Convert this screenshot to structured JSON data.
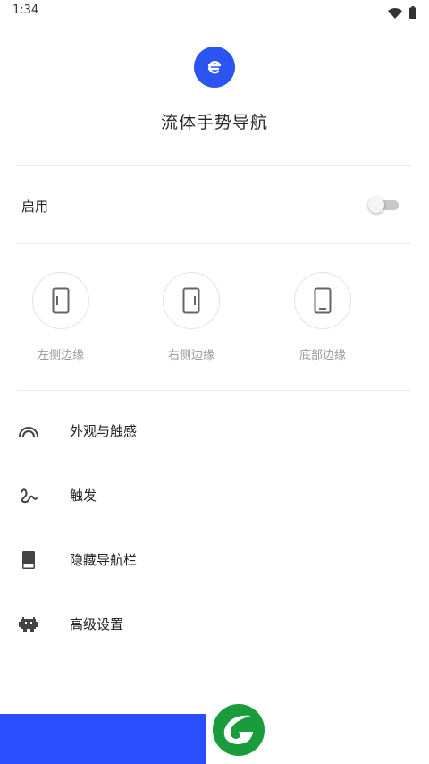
{
  "status_bar": {
    "time": "1:34",
    "icons": [
      "wifi-icon",
      "battery-icon"
    ]
  },
  "app": {
    "title": "流体手势导航",
    "logo_icon": "app-logo-e-icon",
    "accent": "#2b55f2"
  },
  "enable": {
    "label": "启用",
    "toggle_on": false
  },
  "edges": [
    {
      "label": "左侧边缘",
      "icon": "left-edge-phone-icon"
    },
    {
      "label": "右侧边缘",
      "icon": "right-edge-phone-icon"
    },
    {
      "label": "底部边缘",
      "icon": "bottom-edge-phone-icon"
    }
  ],
  "menu": [
    {
      "label": "外观与触感",
      "icon": "arc-icon"
    },
    {
      "label": "触发",
      "icon": "gesture-icon"
    },
    {
      "label": "隐藏导航栏",
      "icon": "navbar-hide-icon"
    },
    {
      "label": "高级设置",
      "icon": "android-icon"
    }
  ],
  "bottom": {
    "bar_color": "#2b4cff",
    "logo_color": "#1a9b3c"
  }
}
